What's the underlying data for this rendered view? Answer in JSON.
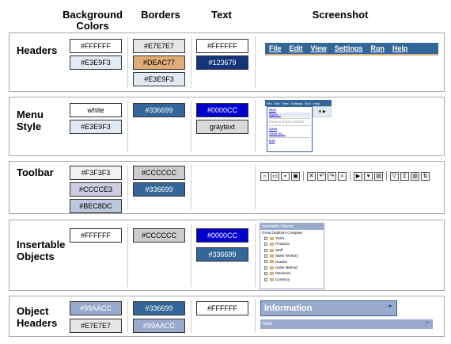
{
  "columns": {
    "background": "Background Colors",
    "borders": "Borders",
    "text": "Text",
    "screenshot": "Screenshot"
  },
  "rows": {
    "headers": {
      "label": "Headers",
      "bg": [
        "#FFFFFF",
        "#E3E9F3"
      ],
      "borders": [
        "#E7E7E7",
        "#DEAC77",
        "#E3E9F3"
      ],
      "text": [
        "#FFFFFF",
        "#123679"
      ],
      "menu": [
        "File",
        "Edit",
        "View",
        "Settings",
        "Run",
        "Help"
      ]
    },
    "menu_style": {
      "label": "Menu Style",
      "bg": [
        "white",
        "#E3E9F3"
      ],
      "borders": [
        "#336699"
      ],
      "text": [
        "#0000CC",
        "graytext"
      ],
      "bar": [
        "File",
        "Edit",
        "View",
        "Settings",
        "Run",
        "Help"
      ],
      "items": [
        "New",
        "Open...",
        "Save",
        "Save As...",
        "Exit"
      ],
      "gray_item": "Save to Report Studio"
    },
    "toolbar": {
      "label": "Toolbar",
      "bg": [
        "#F3F3F3",
        "#CCCCE3",
        "#BEC8DC"
      ],
      "borders": [
        "#CCCCCC",
        "#336699"
      ]
    },
    "insertable": {
      "label": "Insertable Objects",
      "bg": [
        "#FFFFFF"
      ],
      "borders": [
        "#CCCCCC"
      ],
      "text": [
        "#0000CC",
        "#336699"
      ],
      "title": "Insertable Objects",
      "root": "Great Outdoors Company",
      "items": [
        "Years",
        "Products",
        "Staff",
        "Sales Territory",
        "Retailer",
        "Order Method",
        "Measures",
        "Currency"
      ]
    },
    "object_headers": {
      "label": "Object Headers",
      "bg": [
        "#99AACC",
        "#E7E7E7"
      ],
      "borders": [
        "#336699",
        "#99AACC"
      ],
      "text": [
        "#FFFFFF"
      ],
      "info_title": "Information",
      "new_label": "New"
    }
  }
}
